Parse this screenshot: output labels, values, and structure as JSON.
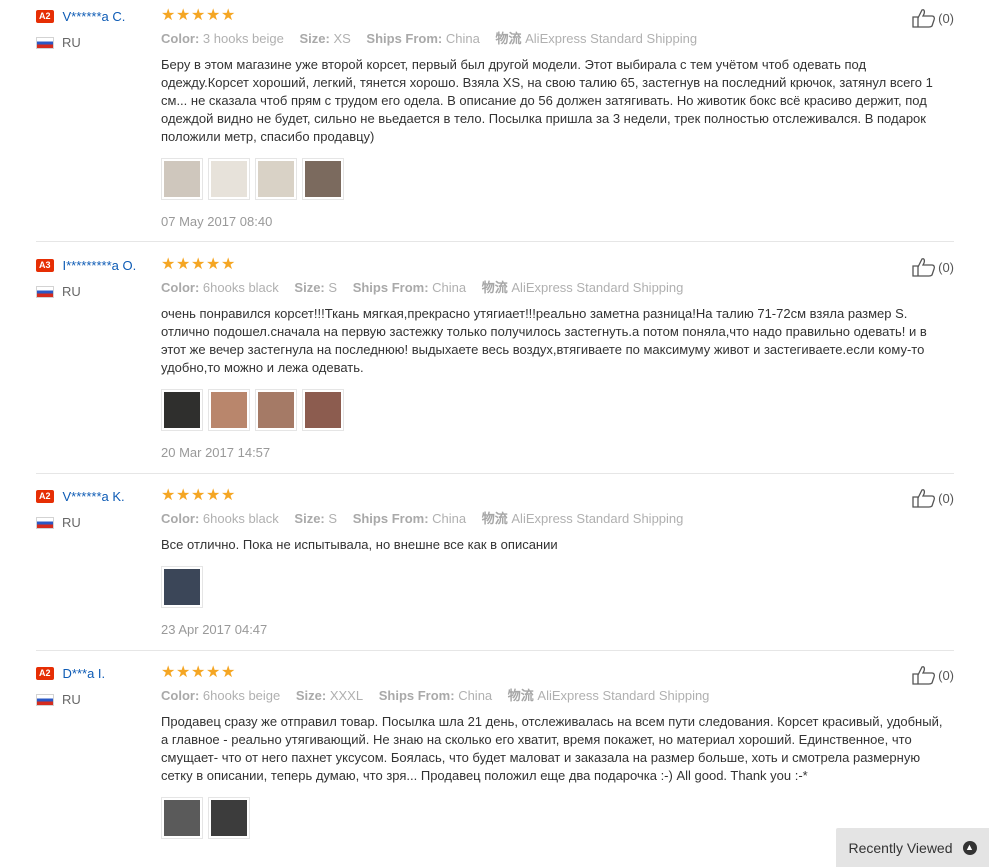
{
  "reviews": [
    {
      "level": "A2",
      "user": "V******a C.",
      "country": "RU",
      "stars": 5,
      "color_label": "Color:",
      "color": "3 hooks beige",
      "size_label": "Size:",
      "size": "XS",
      "ship_label": "Ships From:",
      "ship": "China",
      "logistics_label": "物流",
      "logistics": "AliExpress Standard Shipping",
      "text": "Беру в этом магазине уже второй корсет, первый был другой модели. Этот выбирала с тем учётом чтоб одевать под одежду.Корсет хороший, легкий, тянется хорошо. Взяла XS, на свою талию 65, застегнув на последний крючок, затянул всего 1 см... не сказала чтоб прям с трудом его одела. В описание до 56 должен затягивать. Но животик бокс всё красиво держит, под одеждой видно не будет, сильно не вьедается в тело. Посылка пришла за 3 недели, трек полностью отслеживался. В подарок положили метр, спасибо продавцу)",
      "photos": [
        "#cfc7bd",
        "#e7e2da",
        "#d9d2c6",
        "#7b6a5e"
      ],
      "date": "07 May 2017 08:40",
      "helpful": "(0)"
    },
    {
      "level": "A3",
      "user": "I*********a O.",
      "country": "RU",
      "stars": 5,
      "color_label": "Color:",
      "color": "6hooks black",
      "size_label": "Size:",
      "size": "S",
      "ship_label": "Ships From:",
      "ship": "China",
      "logistics_label": "物流",
      "logistics": "AliExpress Standard Shipping",
      "text": "очень понравился корсет!!!Ткань мягкая,прекрасно утягиает!!!реально заметна разница!На талию 71-72см взяла размер S. отлично подошел.сначала на первую застежку только получилось застегнуть.а потом поняла,что надо правильно одевать! и в этот же вечер застегнула на последнюю! выдыхаете весь воздух,втягиваете по максимуму живот и застегиваете.если кому-то удобно,то можно и лежа одевать.",
      "photos": [
        "#2f2f2d",
        "#b9866c",
        "#a57a66",
        "#8c5c4f"
      ],
      "date": "20 Mar 2017 14:57",
      "helpful": "(0)"
    },
    {
      "level": "A2",
      "user": "V******a K.",
      "country": "RU",
      "stars": 5,
      "color_label": "Color:",
      "color": "6hooks black",
      "size_label": "Size:",
      "size": "S",
      "ship_label": "Ships From:",
      "ship": "China",
      "logistics_label": "物流",
      "logistics": "AliExpress Standard Shipping",
      "text": "Все отлично. Пока не испытывала, но внешне все как в описании",
      "photos": [
        "#3b4658"
      ],
      "date": "23 Apr 2017 04:47",
      "helpful": "(0)"
    },
    {
      "level": "A2",
      "user": "D***a I.",
      "country": "RU",
      "stars": 5,
      "color_label": "Color:",
      "color": "6hooks beige",
      "size_label": "Size:",
      "size": "XXXL",
      "ship_label": "Ships From:",
      "ship": "China",
      "logistics_label": "物流",
      "logistics": "AliExpress Standard Shipping",
      "text": "Продавец сразу же отправил товар. Посылка шла 21 день, отслеживалась на всем пути следования. Корсет красивый, удобный, а главное - реально утягивающий. Не знаю на сколько его хватит, время покажет, но материал хороший. Единственное, что смущает- что от него пахнет уксусом. Боялась, что будет маловат и заказала на размер больше, хоть и смотрела размерную сетку в описании, теперь думаю, что зря... Продавец положил еще два подарочка :-) All good. Thank you :-*",
      "photos": [
        "#5a5a5a",
        "#3c3c3c"
      ],
      "date": "",
      "helpful": "(0)"
    }
  ],
  "recently_viewed": "Recently Viewed",
  "colors": {
    "badge": "#e62e04",
    "username": "#0d5bb5",
    "star": "#f5a623"
  }
}
